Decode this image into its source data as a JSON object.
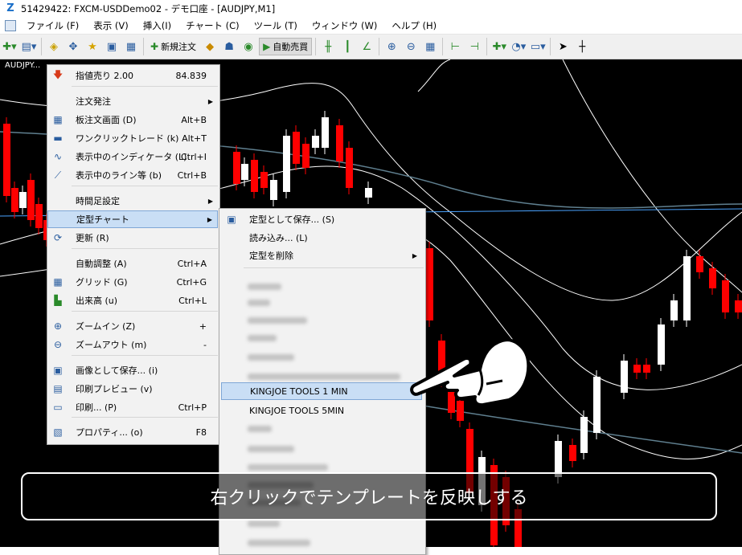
{
  "window": {
    "title": "51429422: FXCM-USDDemo02 - デモ口座 - [AUDJPY,M1]"
  },
  "menubar": [
    "ファイル (F)",
    "表示 (V)",
    "挿入(I)",
    "チャート (C)",
    "ツール (T)",
    "ウィンドウ (W)",
    "ヘルプ (H)"
  ],
  "toolbar": {
    "new_order": "新規注文",
    "auto_trade": "自動売買"
  },
  "chart": {
    "symbol_label": "AUDJPY..."
  },
  "context_menu": {
    "items": [
      {
        "label": "指値売り 2.00",
        "shortcut": "84.839",
        "icon": "red-arrow-down-icon"
      },
      {
        "label": "注文発注",
        "submenu": true
      },
      {
        "label": "板注文画面 (D)",
        "shortcut": "Alt+B",
        "icon": "order-board-icon"
      },
      {
        "label": "ワンクリックトレード (k)",
        "shortcut": "Alt+T",
        "icon": "one-click-trade-icon"
      },
      {
        "label": "表示中のインディケータ (L)",
        "shortcut": "Ctrl+I",
        "icon": "indicators-icon"
      },
      {
        "label": "表示中のライン等 (b)",
        "shortcut": "Ctrl+B",
        "icon": "objects-icon"
      },
      {
        "label": "時間足設定",
        "submenu": true
      },
      {
        "label": "定型チャート",
        "submenu": true
      },
      {
        "label": "更新 (R)",
        "icon": "refresh-icon"
      },
      {
        "label": "自動調整 (A)",
        "shortcut": "Ctrl+A"
      },
      {
        "label": "グリッド (G)",
        "shortcut": "Ctrl+G",
        "icon": "grid-icon"
      },
      {
        "label": "出来高 (u)",
        "shortcut": "Ctrl+L",
        "icon": "volume-icon"
      },
      {
        "label": "ズームイン (Z)",
        "shortcut": "+",
        "icon": "zoom-in-icon"
      },
      {
        "label": "ズームアウト (m)",
        "shortcut": "-",
        "icon": "zoom-out-icon"
      },
      {
        "label": "画像として保存... (i)",
        "icon": "save-image-icon"
      },
      {
        "label": "印刷プレビュー (v)",
        "icon": "print-preview-icon"
      },
      {
        "label": "印刷... (P)",
        "shortcut": "Ctrl+P",
        "icon": "print-icon"
      },
      {
        "label": "プロパティ... (o)",
        "shortcut": "F8",
        "icon": "properties-icon"
      }
    ]
  },
  "submenu": {
    "items": [
      {
        "label": "定型として保存... (S)",
        "icon": "save-template-icon"
      },
      {
        "label": "読み込み... (L)"
      },
      {
        "label": "定型を削除",
        "submenu": true
      },
      {
        "label": "KINGJOE TOOLS 1 MIN",
        "highlighted": true
      },
      {
        "label": "KINGJOE TOOLS 5MIN"
      }
    ]
  },
  "caption": "右クリックでテンプレートを反映しする",
  "colors": {
    "bull": "#ffffff",
    "bear": "#ff0000",
    "band": "#ffffff",
    "ma": "#4aa3ff",
    "selection": "#c9def5"
  }
}
